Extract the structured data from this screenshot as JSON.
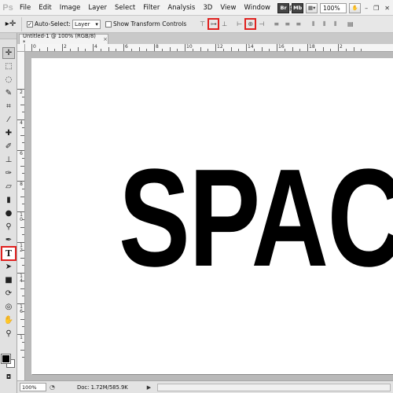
{
  "app": {
    "logo": "Ps"
  },
  "menu": [
    "File",
    "Edit",
    "Image",
    "Layer",
    "Select",
    "Filter",
    "Analysis",
    "3D",
    "View",
    "Window",
    "Help"
  ],
  "menu_right": {
    "bridge": "Br",
    "minibridge": "Mb",
    "zoom": "100%",
    "minimize": "–",
    "restore": "❐",
    "close": "✕"
  },
  "options": {
    "tool_glyph": "▸✛",
    "auto_select_label": "Auto-Select:",
    "auto_select_value": "Layer",
    "transform_label": "Show Transform Controls",
    "auto_select_checked": true,
    "transform_checked": false
  },
  "document": {
    "tab_title": "Untitled-1 @ 100% (RGB/8) *",
    "tab_close": "×"
  },
  "canvas": {
    "text": "SPAC"
  },
  "status": {
    "zoom": "100%",
    "doc": "Doc: 1.72M/585.9K",
    "arrow": "▶"
  },
  "ruler": {
    "h": [
      "0",
      "2",
      "4",
      "6",
      "8",
      "10",
      "12",
      "14",
      "16",
      "18",
      "2"
    ],
    "v": [
      "2",
      "4",
      "6",
      "8",
      "1 0",
      "1 2",
      "1 4",
      "1 6",
      "1"
    ]
  },
  "colors": {
    "foreground": "#000000",
    "background": "#ffffff",
    "highlight": "#e0211f"
  }
}
